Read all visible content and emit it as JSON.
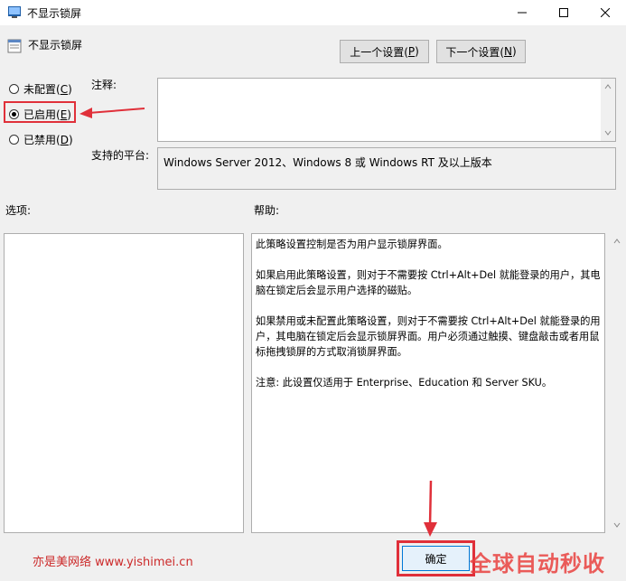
{
  "window": {
    "title": "不显示锁屏",
    "controls": {
      "minimize": "minimize-icon",
      "maximize": "maximize-icon",
      "close": "close-icon"
    }
  },
  "header": {
    "policy_name": "不显示锁屏",
    "prev_label": "上一个设置(",
    "prev_key": "P",
    "next_label": "下一个设置(",
    "next_key": "N",
    "close_paren": ")"
  },
  "state": {
    "options": [
      {
        "label": "未配置(",
        "key": "C",
        "suffix": ")",
        "selected": false
      },
      {
        "label": "已启用(",
        "key": "E",
        "suffix": ")",
        "selected": true
      },
      {
        "label": "已禁用(",
        "key": "D",
        "suffix": ")",
        "selected": false
      }
    ]
  },
  "comment": {
    "label": "注释:",
    "value": ""
  },
  "platform": {
    "label": "支持的平台:",
    "value": "Windows Server 2012、Windows 8 或 Windows RT 及以上版本"
  },
  "options_section": {
    "label": "选项:"
  },
  "help": {
    "label": "帮助:",
    "paragraphs": [
      "此策略设置控制是否为用户显示锁屏界面。",
      "如果启用此策略设置，则对于不需要按 Ctrl+Alt+Del 就能登录的用户，其电脑在锁定后会显示用户选择的磁贴。",
      "如果禁用或未配置此策略设置，则对于不需要按 Ctrl+Alt+Del 就能登录的用户，其电脑在锁定后会显示锁屏界面。用户必须通过触摸、键盘敲击或者用鼠标拖拽锁屏的方式取消锁屏界面。",
      "注意: 此设置仅适用于 Enterprise、Education 和 Server SKU。"
    ]
  },
  "footer": {
    "ok_label": "确定",
    "watermark": "亦是美网络 www.yishimei.cn",
    "brand_watermark": "全球自动秒收"
  },
  "colors": {
    "annotation_red": "#e0303a",
    "ok_border": "#0078d7"
  }
}
